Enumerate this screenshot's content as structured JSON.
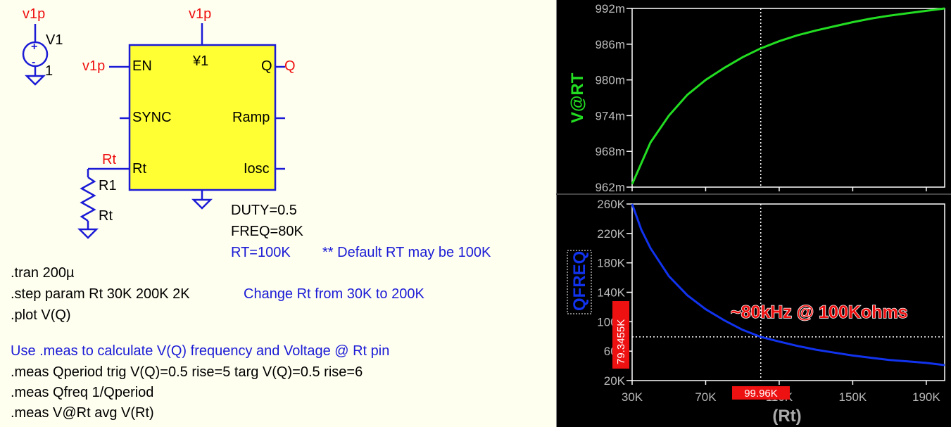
{
  "schematic": {
    "source": {
      "net": "v1p",
      "ref": "V1",
      "value": "1"
    },
    "ic": {
      "ref": "¥1",
      "top_net": "v1p",
      "en_net": "v1p",
      "q_net": "Q",
      "pins": {
        "en": "EN",
        "q": "Q",
        "sync": "SYNC",
        "ramp": "Ramp",
        "rt": "Rt",
        "iosc": "Iosc"
      },
      "params": [
        "DUTY=0.5",
        "FREQ=80K"
      ],
      "rt_param": "RT=100K",
      "rt_comment": "** Default RT may be 100K"
    },
    "resistor": {
      "net": "Rt",
      "ref": "R1",
      "value": "Rt"
    },
    "directives": {
      "tran": ".tran 200µ",
      "step": ".step param Rt 30K 200K 2K",
      "step_comment": "Change Rt from 30K to 200K",
      "plot": ".plot V(Q)",
      "meas_comment": "Use .meas to calculate V(Q) frequency and Voltage @ Rt pin",
      "meas1": ".meas Qperiod trig V(Q)=0.5 rise=5 targ V(Q)=0.5 rise=6",
      "meas2": ".meas Qfreq 1/Qperiod",
      "meas3": ".meas V@Rt avg V(Rt)"
    }
  },
  "plot": {
    "x_label": "(Rt)",
    "x_ticks": [
      "30K",
      "70K",
      "110K",
      "150K",
      "190K"
    ],
    "x_range": [
      30,
      200
    ],
    "cursor_x_readout": "99.96K",
    "cursor_y_readout": "79.3455K",
    "annotation": "~80kHz @ 100Kohms",
    "colors": {
      "upper_trace": "#22dd22",
      "lower_trace": "#1133ee",
      "readout_bg": "#ee1111",
      "annotation": "#ee1111",
      "grid": "#ffffff"
    },
    "upper": {
      "y_label": "V@RT",
      "y_ticks": [
        "992m",
        "986m",
        "980m",
        "974m",
        "968m",
        "962m"
      ],
      "y_range": [
        962,
        992
      ]
    },
    "lower": {
      "y_label": "QFREQ",
      "y_ticks": [
        "260K",
        "220K",
        "180K",
        "140K",
        "100K",
        "60K",
        "20K"
      ],
      "y_range": [
        20,
        260
      ]
    }
  },
  "chart_data": [
    {
      "type": "line",
      "xlabel": "(Rt)",
      "ylabel": "V@RT",
      "xlim": [
        30,
        200
      ],
      "ylim": [
        962,
        992
      ],
      "series": [
        {
          "name": "V@RT",
          "x": [
            30,
            40,
            50,
            60,
            70,
            80,
            90,
            100,
            110,
            120,
            130,
            140,
            150,
            160,
            170,
            180,
            190,
            200
          ],
          "y": [
            962.5,
            969.5,
            974,
            977.5,
            980,
            982,
            983.8,
            985.3,
            986.5,
            987.5,
            988.3,
            989,
            989.7,
            990.3,
            990.8,
            991.2,
            991.6,
            992
          ]
        }
      ]
    },
    {
      "type": "line",
      "xlabel": "(Rt)",
      "ylabel": "QFREQ",
      "xlim": [
        30,
        200
      ],
      "ylim": [
        20,
        260
      ],
      "series": [
        {
          "name": "QFREQ",
          "x": [
            30,
            35,
            40,
            50,
            60,
            70,
            80,
            90,
            100,
            110,
            120,
            130,
            140,
            150,
            160,
            170,
            180,
            190,
            200
          ],
          "y": [
            260,
            225,
            200,
            162,
            136,
            117,
            102,
            89,
            79.3,
            73,
            67,
            62,
            58,
            54,
            51,
            48,
            46,
            44,
            41
          ]
        }
      ]
    }
  ]
}
